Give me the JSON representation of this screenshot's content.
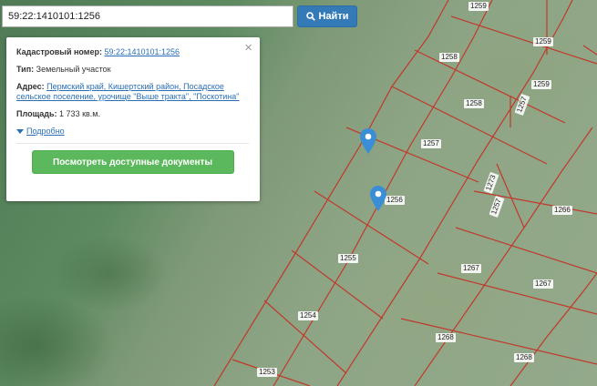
{
  "search": {
    "value": "59:22:1410101:1256",
    "button_label": "Найти"
  },
  "info": {
    "cadastral_label": "Кадастровый номер:",
    "cadastral_value": "59:22:1410101:1256",
    "type_label": "Тип:",
    "type_value": "Земельный участок",
    "address_label": "Адрес:",
    "address_value": "Пермский край, Кишертский район, Посадское сельское поселение, урочище \"Выше тракта\", \"Поскотина\"",
    "area_label": "Площадь:",
    "area_value": "1 733 кв.м.",
    "more_label": "Подробно",
    "docs_button": "Посмотреть доступные документы",
    "close": "×"
  },
  "map": {
    "parcel_line_color": "#c0392b",
    "marker_color": "#3a8ed6",
    "plot_labels": [
      "1259",
      "1259",
      "1258",
      "1259",
      "1258",
      "1257",
      "1257",
      "1257",
      "1256",
      "1266",
      "1255",
      "1267",
      "1267",
      "1254",
      "1268",
      "1268",
      "1253",
      "1273"
    ]
  }
}
